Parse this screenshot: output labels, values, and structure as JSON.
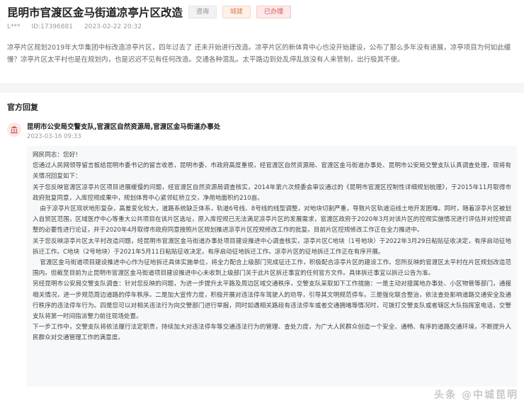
{
  "header": {
    "title": "昆明市官渡区金马街道凉亭片区改造",
    "tags": [
      "咨询",
      "城建",
      "已办理"
    ],
    "user": "L***",
    "id_text": "ID:17396881",
    "datetime": "2023-02-22 20:32",
    "question": "凉亭片区规划2019年大华集团中标改造凉亭片区，四年过去了 还未开始进行改造。凉亭片区的新体育中心也没开始建设，公布了那么多年没有进展，凉亭项目为何如此缓慢？凉亭片区太平村也是在规划内，也是迟迟不见有任何改造。交通各种混乱。太平路边到处乱停乱放没有人来管制，出行极其不便。"
  },
  "reply": {
    "heading": "官方回复",
    "department": "昆明市公安局交警支队,官渡区自然资源局,官渡区金马街道办事处",
    "date": "2023-03-16 09:33",
    "paragraphs": [
      "网民同志：您好！",
      "您通过人民网领导留言板给昆明市委书记的留言收悉，昆明市委、市政府高度重视，经官渡区自然资源局、官渡区金马街道办事处、昆明市公安局交警支队认真调查处理，现将有关情况回复如下：",
      "关于您反映官渡区凉亭片区项目进展缓慢的问题，经官渡区自然资源局调查核实，2014年第六次规委会审议通过的《昆明市官渡区控制性详细规划梳理》，于2015年11月取得市政府批复同意，入库控规成果中，规划体育中心紧邻虹桥立交，净用地面积约210亩。",
      "由于凉亭片区现状地形复杂，高差变化较大，道路系统缺乏体系，轨道6号线、8号线的线型调整，对地块切割严重，导致片区轨道沿线土地开发困难。同时，随着凉亭片区被划入自贸区范围，区域医疗中心等重大公共项目在该片区选址，原入库控规已无法满足凉亭片区的发展需求，官渡区政府于2020年3月对该片区的控规实施情况进行评估并对控规调整的必要性进行论证，并于2020年4月取得市政府同意按照片区规划推进凉亭片区控规修改工作的批复。目前片区控规修改工作正在全力推进中。",
      "关于您反映凉亭片区太平村改造问题，经昆明市官渡区金马街道办事处项目建设推进中心调查核实，凉亭片区C地块（1号地块）于2022年3月29日粘贴征收决定，有序启动征地拆迁工作。C地块（2号地块）于2021年5月11日粘贴征收决定，有序启动征地拆迁工作。凉亭片区的征地拆迁工作正在有序开展。",
      "官渡区金马街道项目建设推进中心作为征地拆迁具体实施单位，将全力配合上级部门完成征迁工作，积极配合凉亭片区的建设工作。您所反映的官渡区太平村在片区规划改造范围内。但截至目前为止昆明市官渡区金马街道项目建设推进中心未收到上级部门关于此片区拆迁事宜的任何官方文件。具体拆迁事宜以拆迁公告为准。",
      "另经昆明市公安局交警支队调查：针对您反映的问题，为进一步提升太平路及周边区域交通秩序，交警支队采取如下工作措施：一是主动对接属地办事处、小区物管等部门，通报相关情况，进一步规范周边道路的停车秩序。二是加大宣传力度，积极开展对违法停车驾驶人的劝导，引导其文明规范停车。三是强化联合整治，依法查处影响道路交通安全及通行秩序的违法停车行为。四是您可以对相关违法行为向交警部门进行举报，同时如遇相关路段有违法停车或者交通拥堵等情况时，可拨打交警支队或者辖区大队指挥室电话，交警支队将第一时间指派警力前往现场处置。",
      "下一步工作中，交警支队将依法履行法定职责，持续加大对违法停车等交通违法行为的管理、查处力度，为广大人民群众创造一个安全、通畅、有序的道路交通环境，不断提升人民群众对交通管理工作的满意度。"
    ]
  },
  "watermark": "头条 @中城昆明",
  "colors": {
    "accent_red": "#d9534f",
    "tag_orange": "#e0794a",
    "tag_gray": "#8a8a8a",
    "panel_bg": "#f7f8f9"
  },
  "icons": {
    "department": "government-building-icon"
  }
}
